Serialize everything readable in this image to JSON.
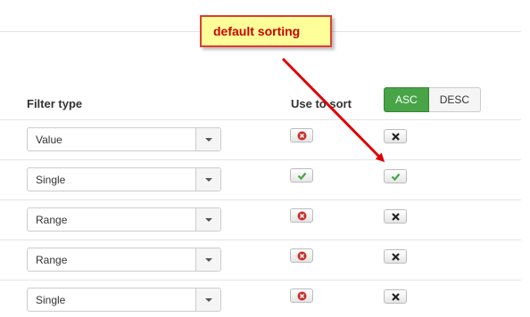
{
  "annotation": {
    "callout_text": "default sorting"
  },
  "headers": {
    "filter_type": "Filter type",
    "use_to_sort": "Use to sort"
  },
  "sort_direction": {
    "asc_label": "ASC",
    "desc_label": "DESC",
    "selected": "ASC"
  },
  "rows": [
    {
      "filter_type": "Value",
      "use_to_sort": false,
      "default_sort": false
    },
    {
      "filter_type": "Single",
      "use_to_sort": true,
      "default_sort": true
    },
    {
      "filter_type": "Range",
      "use_to_sort": false,
      "default_sort": false
    },
    {
      "filter_type": "Range",
      "use_to_sort": false,
      "default_sort": false
    },
    {
      "filter_type": "Single",
      "use_to_sort": false,
      "default_sort": false
    }
  ],
  "icons": {
    "disabled": "circle-x-icon",
    "enabled": "check-icon",
    "not_default": "x-icon",
    "dropdown": "caret-down-icon"
  },
  "colors": {
    "asc_active": "#47a447",
    "check_green": "#47a447",
    "disabled_red": "#c9302c",
    "callout_border": "#e03c31",
    "callout_fill": "#ffff99",
    "callout_text": "#cc0000",
    "arrow": "#e00000"
  }
}
